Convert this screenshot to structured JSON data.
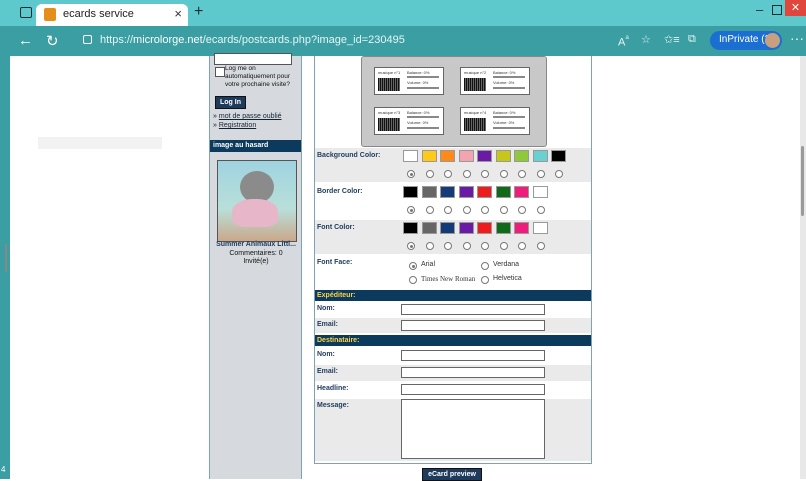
{
  "browser": {
    "tab_title": "ecards service",
    "tab_close": "×",
    "new_tab": "+",
    "url_prefix": "https://",
    "url_domain": "microlorge.net",
    "url_path": "/ecards/postcards.php?image_id=230495",
    "inprivate_label": "InPrivate (2)",
    "icons": [
      "tab-actions-icon",
      "back-icon",
      "refresh-icon",
      "lock-icon",
      "read-aloud-icon",
      "favorite-icon",
      "favorites-icon",
      "collections-icon",
      "more-icon"
    ],
    "accent": "#5ec9cd",
    "inprivate_color": "#1b6fd1"
  },
  "sidebar": {
    "remember_text": "Log me on automatiquement pour votre prochaine visite?",
    "login_button": "Log In",
    "forgot_link": "mot de passe oublié",
    "register_link": "Registration",
    "link_prefix": "»",
    "random_header": "image au hasard",
    "image_title": "Summer Animaux Littl...",
    "comments": "Commentaires: 0",
    "author": "Invité(e)"
  },
  "form": {
    "background_color_label": "Background Color:",
    "border_color_label": "Border Color:",
    "font_color_label": "Font Color:",
    "font_face_label": "Font Face:",
    "background_colors": [
      "#ffffff",
      "#ffc91a",
      "#ff8a1a",
      "#f4a3b0",
      "#6a1aa5",
      "#c7c71a",
      "#8fc93a",
      "#6ad0d0",
      "#000000"
    ],
    "border_colors": [
      "#000000",
      "#666666",
      "#153a7a",
      "#6a1aa5",
      "#ee1c1c",
      "#0f6a1a",
      "#ee1c7a",
      "#ffffff"
    ],
    "font_colors": [
      "#000000",
      "#666666",
      "#153a7a",
      "#6a1aa5",
      "#ee1c1c",
      "#0f6a1a",
      "#ee1c7a",
      "#ffffff"
    ],
    "selected_background": 0,
    "selected_border": 0,
    "selected_font": 0,
    "fonts": [
      "Arial",
      "Verdana",
      "Times New Roman",
      "Helvetica"
    ],
    "selected_font_face": "Arial",
    "sender_header": "Expéditeur:",
    "recipient_header": "Destinataire:",
    "name_label": "Nom:",
    "email_label": "Email:",
    "headline_label": "Headline:",
    "message_label": "Message:",
    "preview_button": "eCard preview",
    "header_color": "#0b3a5c",
    "header_text_color": "#ffd24a"
  }
}
